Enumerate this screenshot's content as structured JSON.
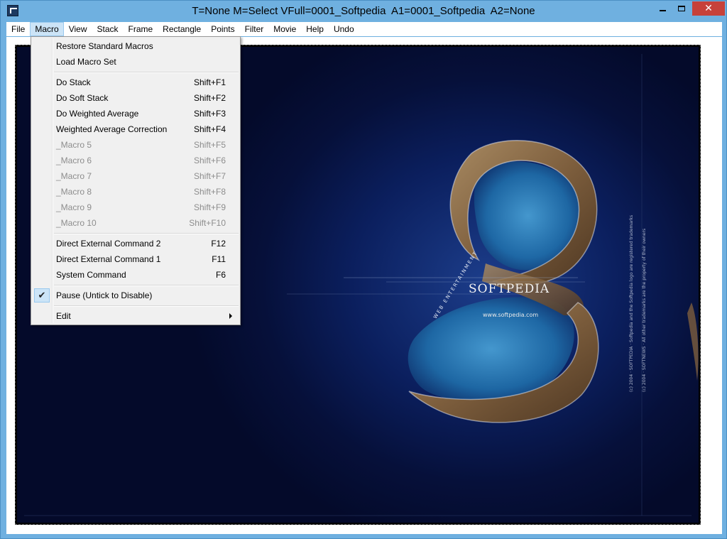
{
  "window": {
    "title": "T=None M=Select VFull=0001_Softpedia  A1=0001_Softpedia  A2=None",
    "close_glyph": "✕"
  },
  "menubar": {
    "items": [
      "File",
      "Macro",
      "View",
      "Stack",
      "Frame",
      "Rectangle",
      "Points",
      "Filter",
      "Movie",
      "Help",
      "Undo"
    ],
    "active": "Macro"
  },
  "macro_menu": {
    "items": [
      {
        "label": "Restore Standard Macros",
        "shortcut": "",
        "enabled": true
      },
      {
        "label": "Load Macro Set",
        "shortcut": "",
        "enabled": true
      },
      {
        "label": "Do Stack",
        "shortcut": "Shift+F1",
        "enabled": true
      },
      {
        "label": "Do Soft Stack",
        "shortcut": "Shift+F2",
        "enabled": true
      },
      {
        "label": "Do Weighted Average",
        "shortcut": "Shift+F3",
        "enabled": true
      },
      {
        "label": "Weighted Average Correction",
        "shortcut": "Shift+F4",
        "enabled": true
      },
      {
        "label": "_Macro 5",
        "shortcut": "Shift+F5",
        "enabled": false
      },
      {
        "label": "_Macro 6",
        "shortcut": "Shift+F6",
        "enabled": false
      },
      {
        "label": "_Macro 7",
        "shortcut": "Shift+F7",
        "enabled": false
      },
      {
        "label": "_Macro 8",
        "shortcut": "Shift+F8",
        "enabled": false
      },
      {
        "label": "_Macro 9",
        "shortcut": "Shift+F9",
        "enabled": false
      },
      {
        "label": "_Macro 10",
        "shortcut": "Shift+F10",
        "enabled": false
      },
      {
        "label": "Direct External Command 2",
        "shortcut": "F12",
        "enabled": true
      },
      {
        "label": "Direct External Command 1",
        "shortcut": "F11",
        "enabled": true
      },
      {
        "label": "System Command",
        "shortcut": "F6",
        "enabled": true
      },
      {
        "label": "Pause (Untick to Disable)",
        "shortcut": "",
        "enabled": true,
        "checked": true,
        "check_glyph": "✔"
      },
      {
        "label": "Edit",
        "shortcut": "",
        "enabled": true,
        "submenu": true
      }
    ]
  },
  "image": {
    "logo_text": "SOFTPEDIA",
    "url_text": "www.softpedia.com",
    "tagline": "WEB ENTERTAINMENT",
    "vertical_note_1": "(c) 2004 · SOFTPEDIA · Softpedia and the Softpedia logo are registered trademarks",
    "vertical_note_2": "(c) 2004 · SOFTNEWS · All other trademarks are the property of their owners",
    "colors": {
      "ocean_deep": "#06103a",
      "ocean_mid": "#1c3d8a",
      "rock": "#8a6a44",
      "lagoon": "#2f86c4"
    }
  }
}
